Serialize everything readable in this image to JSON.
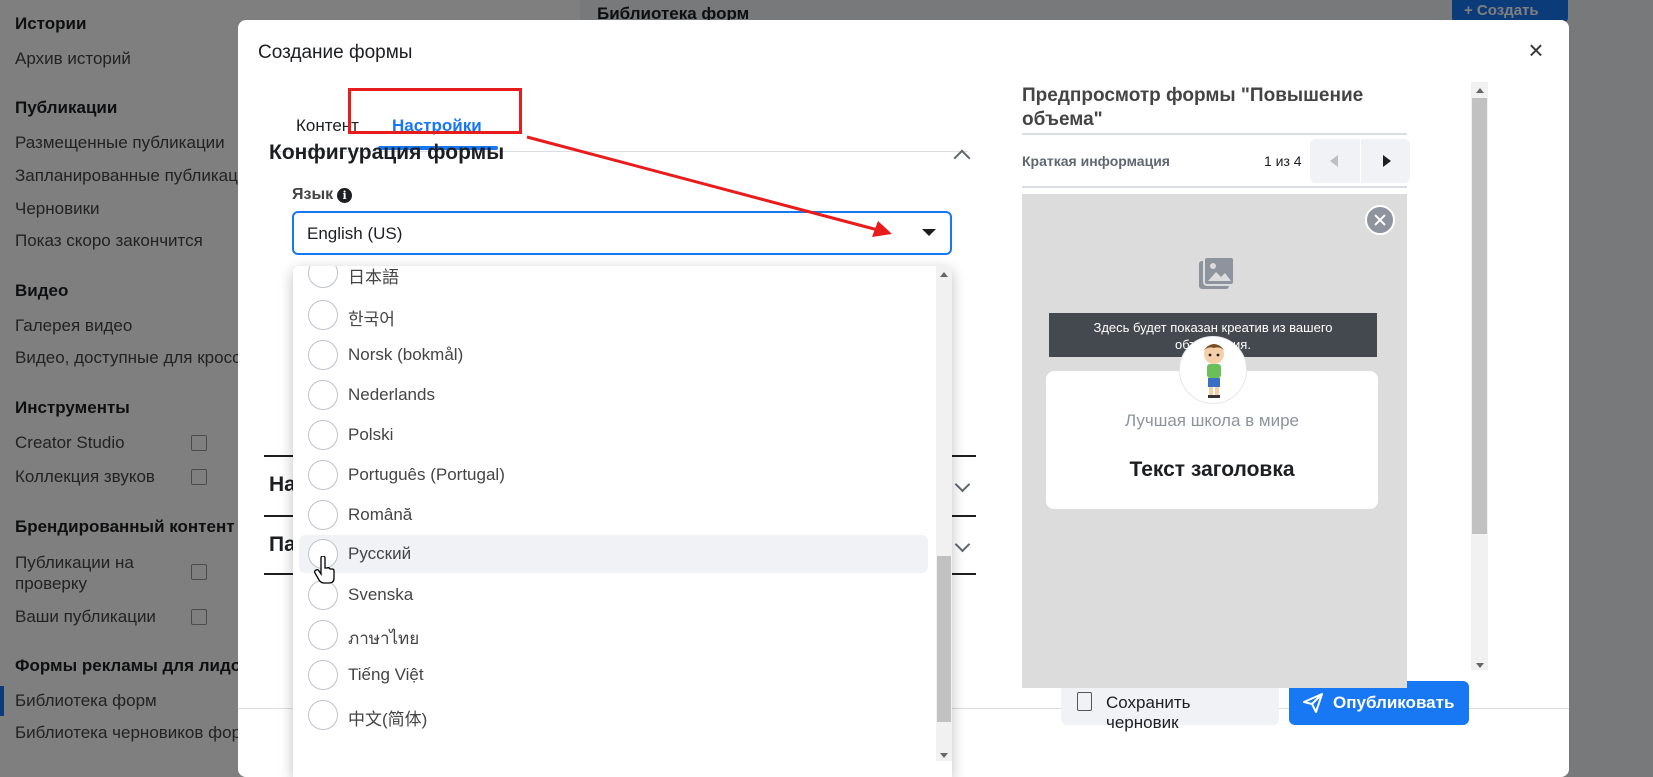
{
  "sidebar": {
    "sections": [
      {
        "title": "Истории",
        "items": [
          {
            "label": "Архив историй"
          }
        ]
      },
      {
        "title": "Публикации",
        "items": [
          {
            "label": "Размещенные публикации"
          },
          {
            "label": "Запланированные публикации"
          },
          {
            "label": "Черновики"
          },
          {
            "label": "Показ скоро закончится"
          }
        ]
      },
      {
        "title": "Видео",
        "items": [
          {
            "label": "Галерея видео"
          },
          {
            "label": "Видео, доступные для кросспостинга"
          }
        ]
      },
      {
        "title": "Инструменты",
        "items": [
          {
            "label": "Creator Studio"
          },
          {
            "label": "Коллекция звуков"
          }
        ]
      },
      {
        "title": "Брендированный контент",
        "items": [
          {
            "label": "Публикации на проверку"
          },
          {
            "label": "Ваши публикации"
          }
        ]
      },
      {
        "title": "Формы рекламы для лидов",
        "items": [
          {
            "label": "Библиотека форм"
          },
          {
            "label": "Библиотека черновиков форм"
          }
        ]
      }
    ]
  },
  "background": {
    "library_title": "Библиотека форм",
    "create_button": "+ Создать"
  },
  "modal": {
    "title": "Создание формы",
    "close_symbol": "×",
    "tabs": [
      {
        "label": "Контент",
        "active": false
      },
      {
        "label": "Настройки",
        "active": true
      }
    ],
    "config": {
      "title": "Конфигурация формы",
      "language_label": "Язык",
      "info_symbol": "i",
      "language_value": "English (US)"
    },
    "collapsed_sections": [
      {
        "label": "На"
      },
      {
        "label": "Па"
      }
    ],
    "footer": {
      "save_draft_label": "Сохранить черновик",
      "publish_label": "Опубликовать"
    }
  },
  "language_dropdown": {
    "options": [
      {
        "label": "日本語",
        "hover": false
      },
      {
        "label": "한국어",
        "hover": false
      },
      {
        "label": "Norsk (bokmål)",
        "hover": false
      },
      {
        "label": "Nederlands",
        "hover": false
      },
      {
        "label": "Polski",
        "hover": false
      },
      {
        "label": "Português (Portugal)",
        "hover": false
      },
      {
        "label": "Română",
        "hover": false
      },
      {
        "label": "Русский",
        "hover": true
      },
      {
        "label": "Svenska",
        "hover": false
      },
      {
        "label": "ภาษาไทย",
        "hover": false
      },
      {
        "label": "Tiếng Việt",
        "hover": false
      },
      {
        "label": "中文(简体)",
        "hover": false
      }
    ]
  },
  "preview": {
    "title": "Предпросмотр формы \"Повышение объема\"",
    "section_label": "Краткая информация",
    "page_indicator": "1 из 4",
    "banner_text": "Здесь будет показан креатив из вашего объявления.",
    "company_name": "Лучшая школа в мире",
    "headline": "Текст заголовка"
  },
  "colors": {
    "accent": "#1877f2",
    "annotation": "#e81c1c"
  }
}
